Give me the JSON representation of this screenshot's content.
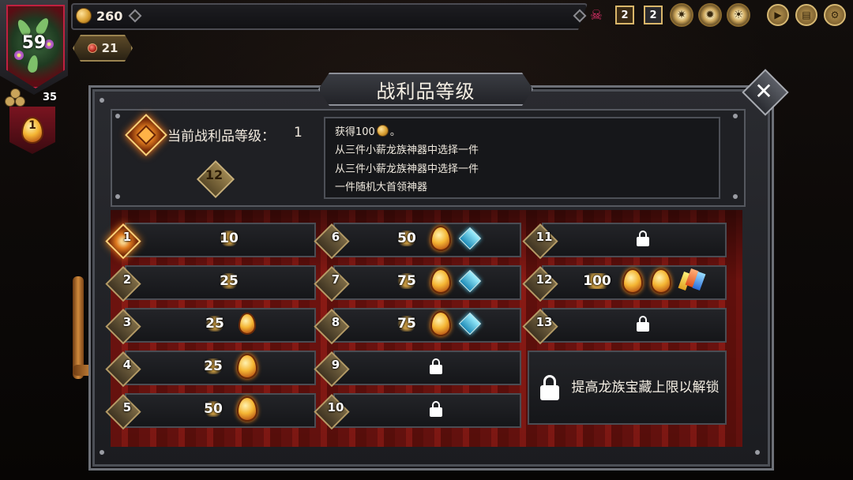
{
  "hud": {
    "gold": "260",
    "hp": "21",
    "portrait_level": "59",
    "sub_level": "35",
    "egg_count": "1",
    "icon_badges": [
      "2",
      "2"
    ],
    "icons": [
      "pink-skull-icon",
      "book-icon",
      "scroll-icon",
      "gold-gear-icon",
      "gold-gear-icon-2",
      "sun-gear-icon",
      "play-button-icon",
      "map-icon",
      "settings-icon"
    ]
  },
  "panel": {
    "title": "战利品等级",
    "close_label": "✕"
  },
  "current": {
    "label": "当前战利品等级：",
    "value": "1",
    "next_level": "12"
  },
  "rewards": {
    "line1_prefix": "获得100",
    "line1_suffix": "。",
    "line2": "从三件小薪龙族神器中选择一件",
    "line3": "从三件小薪龙族神器中选择一件",
    "line4": "一件随机大首领神器"
  },
  "tiers": [
    {
      "num": "1",
      "value": "10",
      "eggs": 0,
      "active": true
    },
    {
      "num": "2",
      "value": "25",
      "eggs": 0
    },
    {
      "num": "3",
      "value": "25",
      "eggs": 1
    },
    {
      "num": "4",
      "value": "25",
      "eggs": 1
    },
    {
      "num": "5",
      "value": "50",
      "eggs": 1
    },
    {
      "num": "6",
      "value": "50",
      "eggs": 1,
      "relic": true
    },
    {
      "num": "7",
      "value": "75",
      "eggs": 1,
      "relic": true
    },
    {
      "num": "8",
      "value": "75",
      "eggs": 1,
      "relic": true
    },
    {
      "num": "9",
      "locked": true
    },
    {
      "num": "10",
      "locked": true
    },
    {
      "num": "11",
      "locked": true
    },
    {
      "num": "12",
      "value": "100",
      "eggs": 2,
      "crystal": true
    },
    {
      "num": "13",
      "locked": true
    }
  ],
  "unlock_hint": "提高龙族宝藏上限以解锁",
  "colors": {
    "accent_orange": "#e07b1f",
    "curtain_red": "#8a1812",
    "panel_dark": "#1f2024",
    "close_red": "#c02040"
  }
}
